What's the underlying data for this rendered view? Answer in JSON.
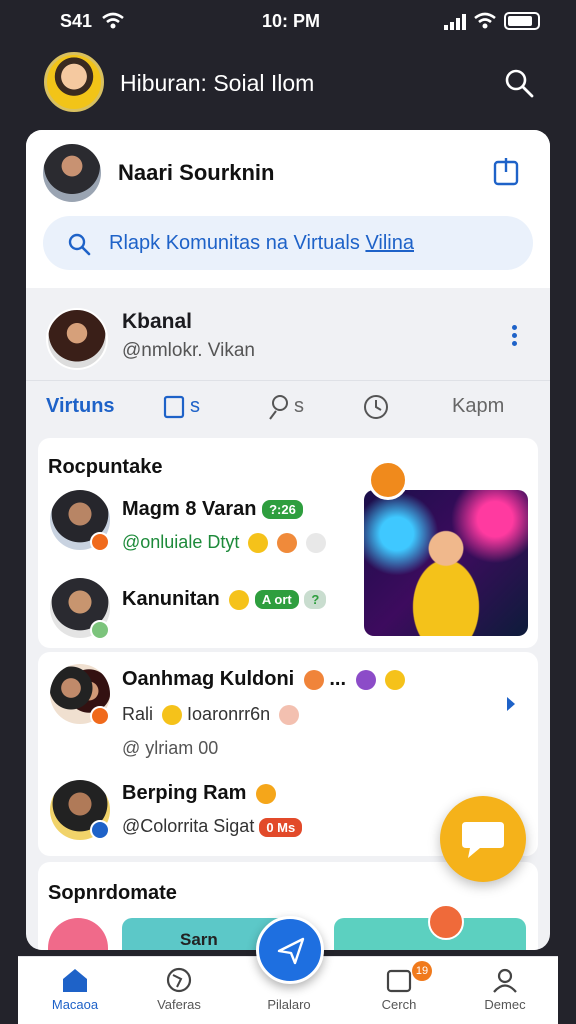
{
  "status_bar": {
    "time_left": "S41",
    "time_center": "10: PM"
  },
  "header": {
    "title": "Hiburan: Soial Ilom"
  },
  "user": {
    "name": "Naari Sourknin"
  },
  "search": {
    "text": "Rlapk Komunitas na Virtuals",
    "link": "Vilina"
  },
  "profile": {
    "name": "Kbanal",
    "handle": "@nmlokr. Vikan"
  },
  "tabs": [
    {
      "label": "Virtuns"
    },
    {
      "label": "s"
    },
    {
      "label": "s"
    },
    {
      "label": "Kapm"
    }
  ],
  "feed": {
    "section_title": "Rocpuntake",
    "items": [
      {
        "name": "Magm 8 Varan",
        "pill": "?:26",
        "sub": "@onluiale Dtyt"
      },
      {
        "name": "Kanunitan",
        "pill": "A ort",
        "pill2": "?"
      },
      {
        "name": "Oanhmag Kuldoni",
        "suffix": "...",
        "sub": "Rali",
        "sub2": "Ioaronrr6n",
        "meta": "@ ylriam 00"
      },
      {
        "name": "Berping Ram",
        "sub": "@Colorrita Sigat",
        "pill": "0 Ms"
      }
    ]
  },
  "bottom_section": {
    "title": "Sopnrdomate",
    "thumb_text": "Sarn"
  },
  "bottom_nav": {
    "items": [
      {
        "label": "Macaoa"
      },
      {
        "label": "Vaferas"
      },
      {
        "label": "Pilalaro"
      },
      {
        "label": "Cerch"
      },
      {
        "label": "Demec"
      }
    ],
    "badge": "19"
  },
  "colors": {
    "accent": "#1e62c8",
    "fab": "#f5b21a",
    "background": "#23232b"
  }
}
